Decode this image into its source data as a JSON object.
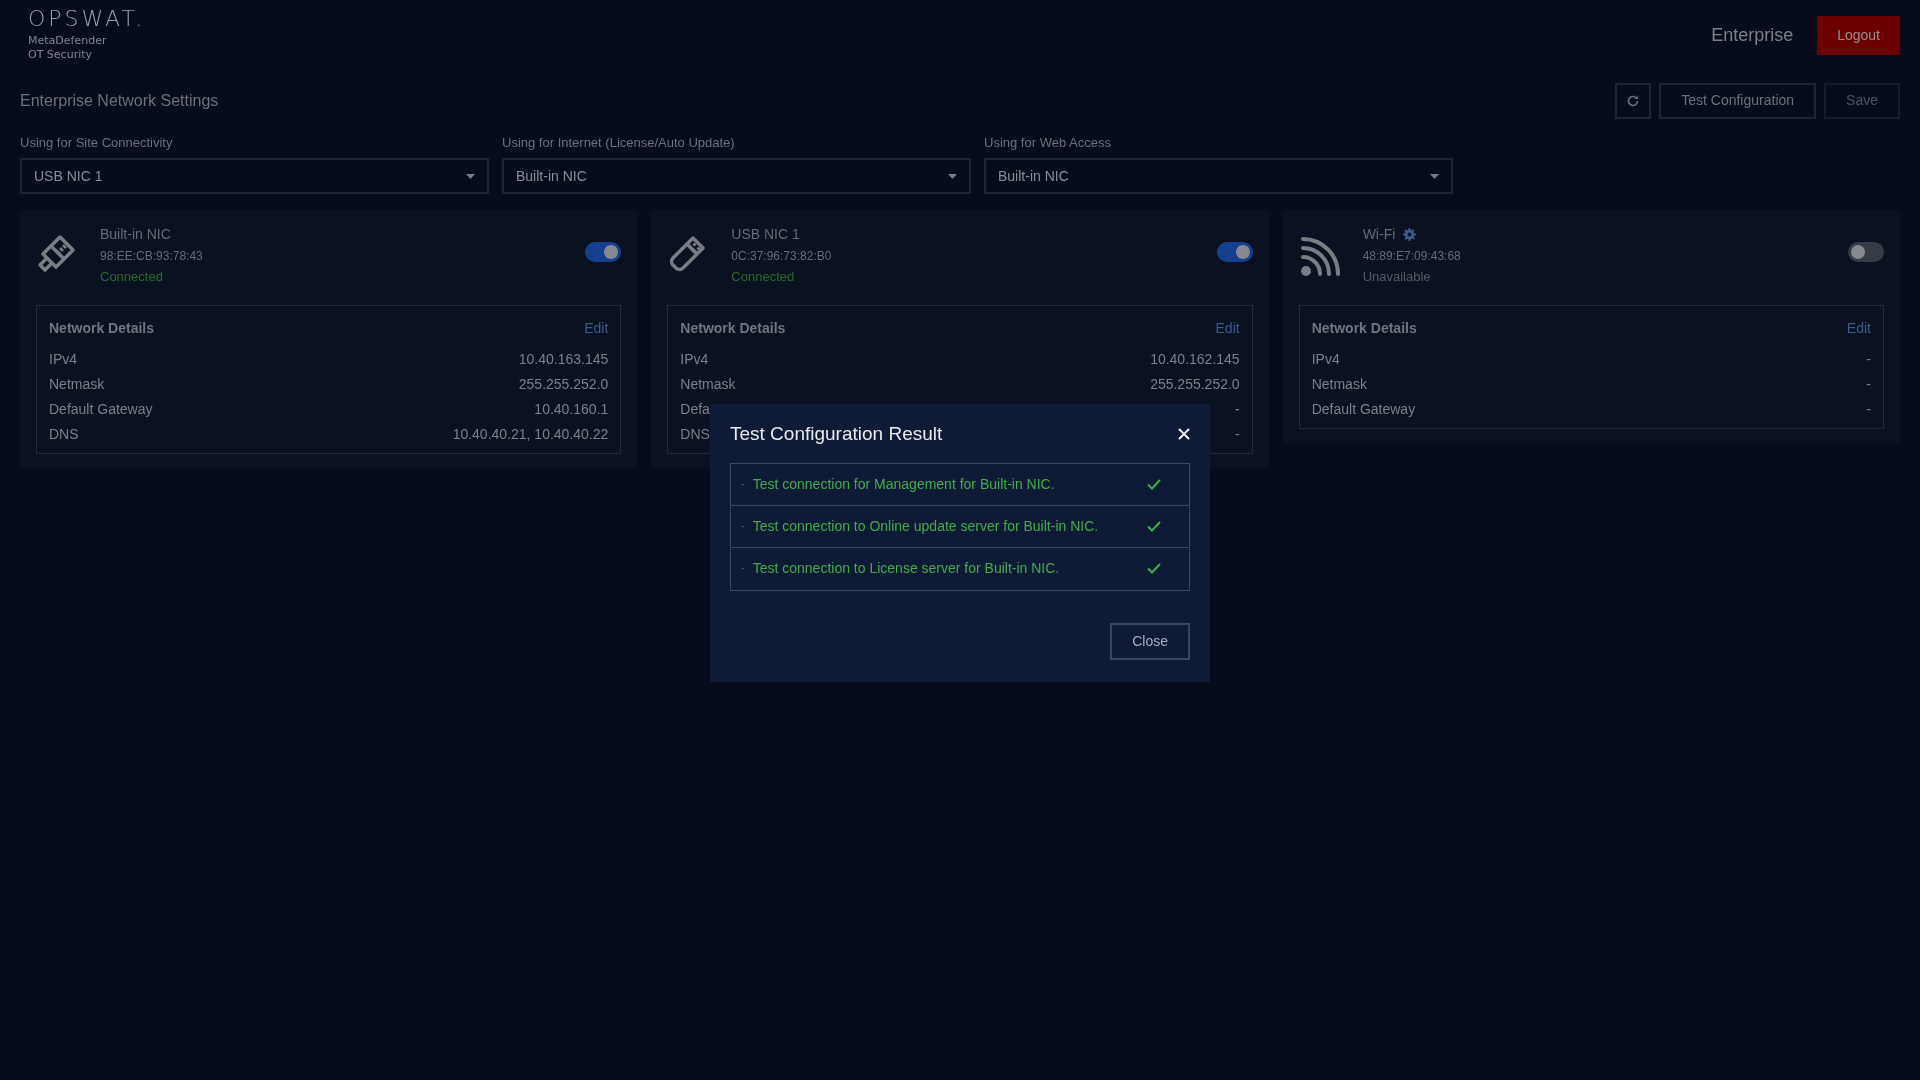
{
  "logo": {
    "brand": "OPSWAT.",
    "product": "MetaDefender",
    "edition": "OT Security"
  },
  "header": {
    "edition": "Enterprise",
    "logout": "Logout"
  },
  "page_title": "Enterprise Network Settings",
  "toolbar": [
    {
      "kind": "refresh",
      "disabled": false
    },
    {
      "kind": "text",
      "label": "Test Configuration",
      "disabled": false
    },
    {
      "kind": "text",
      "label": "Save",
      "disabled": true
    }
  ],
  "dropdowns": [
    {
      "label": "Using for Site Connectivity",
      "value": "USB NIC 1"
    },
    {
      "label": "Using for Internet (License/Auto Update)",
      "value": "Built-in NIC"
    },
    {
      "label": "Using for Web Access",
      "value": "Built-in NIC"
    }
  ],
  "networks": [
    {
      "kind": "ethernet",
      "name": "Built-in NIC",
      "settings": false,
      "mac": "98:EE:CB:93:78:43",
      "status": "Connected",
      "connected": true,
      "enabled": true,
      "details_title": "Network Details",
      "edit": "Edit",
      "rows": [
        {
          "label": "IPv4",
          "value": "10.40.163.145"
        },
        {
          "label": "Netmask",
          "value": "255.255.252.0"
        },
        {
          "label": "Default Gateway",
          "value": "10.40.160.1"
        },
        {
          "label": "DNS",
          "value": "10.40.40.21, 10.40.40.22"
        }
      ]
    },
    {
      "kind": "usb",
      "name": "USB NIC 1",
      "settings": false,
      "mac": "0C:37:96:73:82:B0",
      "status": "Connected",
      "connected": true,
      "enabled": true,
      "details_title": "Network Details",
      "edit": "Edit",
      "rows": [
        {
          "label": "IPv4",
          "value": "10.40.162.145"
        },
        {
          "label": "Netmask",
          "value": "255.255.252.0"
        },
        {
          "label": "Defa",
          "value": "-"
        },
        {
          "label": "DNS",
          "value": "-"
        }
      ]
    },
    {
      "kind": "wifi",
      "name": "Wi-Fi",
      "settings": true,
      "mac": "48:89:E7:09:43:68",
      "status": "Unavailable",
      "connected": false,
      "enabled": false,
      "details_title": "Network Details",
      "edit": "Edit",
      "rows": [
        {
          "label": "IPv4",
          "value": "-"
        },
        {
          "label": "Netmask",
          "value": "-"
        },
        {
          "label": "Default Gateway",
          "value": "-"
        }
      ]
    }
  ],
  "dialog": {
    "title": "Test Configuration Result",
    "results": [
      {
        "bullet": "·",
        "text": "Test connection for Management for Built-in NIC.",
        "passed": true
      },
      {
        "bullet": "·",
        "text": "Test connection to Online update server for Built-in NIC.",
        "passed": true
      },
      {
        "bullet": "·",
        "text": "Test connection to License server for Built-in NIC.",
        "passed": true
      }
    ],
    "close": "Close"
  }
}
